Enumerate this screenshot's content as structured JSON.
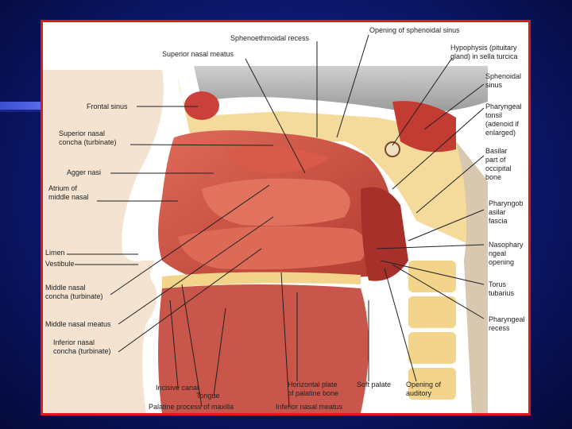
{
  "colors": {
    "background": "#0d1a78",
    "frame": "#e01a1a",
    "tissue": "#c94a3e",
    "bone": "#f2d48a",
    "brain": "#b8b8b8"
  },
  "labels": {
    "sphenoethmoidal_recess": "Sphenoethmoidal recess",
    "opening_sphenoidal_sinus": "Opening of sphenoidal sinus",
    "superior_nasal_meatus": "Superior nasal meatus",
    "hypophysis": "Hypophysis (pituitary\ngland) in sella turcica",
    "sphenoidal_sinus": "Sphenoidal\nsinus",
    "frontal_sinus": "Frontal sinus",
    "pharyngeal_tonsil": "Pharyngeal\ntonsil\n(adenoid if\nenlarged)",
    "superior_nasal_concha": "Superior nasal\nconcha (turbinate)",
    "basilar_part": "Basilar\npart of\noccipital\nbone",
    "agger_nasi": "Agger nasi",
    "atrium_middle_nasal": "Atrium of\nmiddle nasal",
    "pharyngobasilar_fascia": "Pharyngob\nasilar\nfascia",
    "limen": "Limen",
    "vestibule": "Vestibule",
    "nasopharyngeal_opening": "Nasophary\nngeal\nopening",
    "middle_nasal_concha": "Middle nasal\nconcha (turbinate)",
    "torus_tubarius": "Torus\ntubarius",
    "middle_nasal_meatus": "Middle nasal meatus",
    "pharyngeal_recess": "Pharyngeal\nrecess",
    "inferior_nasal_concha": "Inferior nasal\nconcha (turbinate)",
    "soft_palate": "Soft palate",
    "incisive_canal": "Incisive canal",
    "tongue": "Tongue",
    "horizontal_plate": "Horizontal plate\nof palatine bone",
    "opening_auditory": "Opening of\nauditory",
    "palatine_process": "Palatine process of maxilla",
    "inferior_nasal_meatus": "Inferior nasal meatus"
  }
}
